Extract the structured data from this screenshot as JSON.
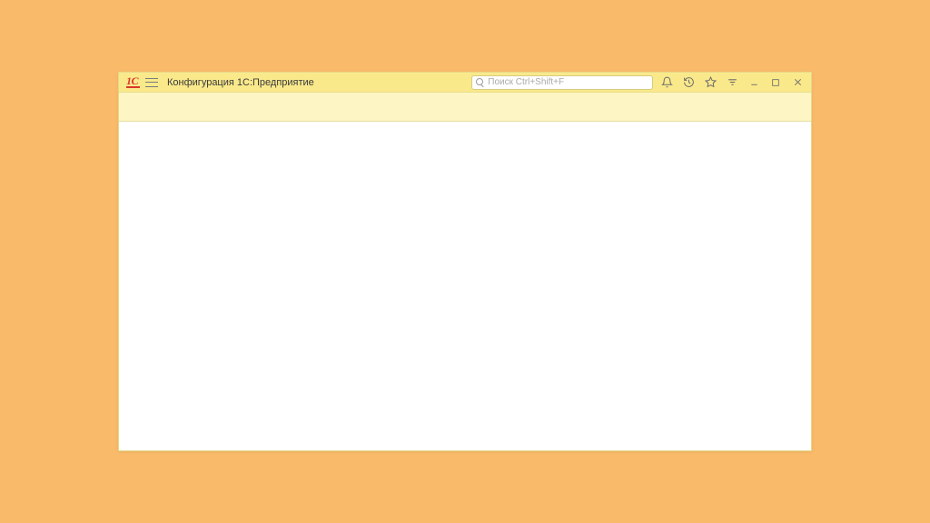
{
  "header": {
    "logo_text": "1C",
    "title": "Конфигурация 1С:Предприятие",
    "search_placeholder": "Поиск Ctrl+Shift+F"
  }
}
